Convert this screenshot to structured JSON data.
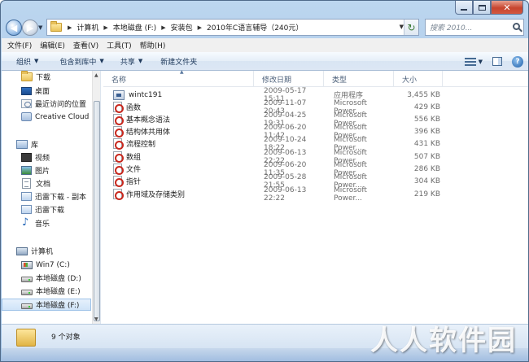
{
  "address": {
    "crumbs": [
      "计算机",
      "本地磁盘 (F:)",
      "安装包",
      "2010年C语言辅导（240元）"
    ],
    "search_placeholder": "搜索 2010..."
  },
  "menu": [
    "文件(F)",
    "编辑(E)",
    "查看(V)",
    "工具(T)",
    "帮助(H)"
  ],
  "toolbar": {
    "organize": "组织",
    "include_library": "包含到库中",
    "share": "共享",
    "new_folder": "新建文件夹"
  },
  "nav": {
    "favorites": [
      {
        "label": "下载",
        "icon": "download-folder-icon"
      },
      {
        "label": "桌面",
        "icon": "desktop-icon"
      },
      {
        "label": "最近访问的位置",
        "icon": "recent-places-icon"
      },
      {
        "label": "Creative Cloud F",
        "icon": "creative-cloud-icon"
      }
    ],
    "library_label": "库",
    "libraries": [
      {
        "label": "视频",
        "icon": "video-library-icon"
      },
      {
        "label": "图片",
        "icon": "picture-library-icon"
      },
      {
        "label": "文档",
        "icon": "document-library-icon"
      },
      {
        "label": "迅雷下载 - 副本",
        "icon": "thunder-download-icon"
      },
      {
        "label": "迅雷下载",
        "icon": "thunder-download-icon"
      },
      {
        "label": "音乐",
        "icon": "music-library-icon"
      }
    ],
    "computer_label": "计算机",
    "drives": [
      {
        "label": "Win7 (C:)",
        "icon": "windows-drive-icon"
      },
      {
        "label": "本地磁盘 (D:)",
        "icon": "hard-drive-icon"
      },
      {
        "label": "本地磁盘 (E:)",
        "icon": "hard-drive-icon"
      },
      {
        "label": "本地磁盘 (F:)",
        "icon": "hard-drive-icon"
      }
    ]
  },
  "columns": {
    "name": "名称",
    "date": "修改日期",
    "type": "类型",
    "size": "大小"
  },
  "files": [
    {
      "name": "wintc191",
      "date": "2009-05-17 15:11",
      "type": "应用程序",
      "size": "3,455 KB",
      "icon": "exe-icon"
    },
    {
      "name": "函数",
      "date": "2009-11-07 20:43",
      "type": "Microsoft Power...",
      "size": "429 KB",
      "icon": "pdf-icon"
    },
    {
      "name": "基本概念语法",
      "date": "2009-04-25 19:31",
      "type": "Microsoft Power...",
      "size": "556 KB",
      "icon": "pdf-icon"
    },
    {
      "name": "结构体共用体",
      "date": "2009-06-20 11:42",
      "type": "Microsoft Power...",
      "size": "396 KB",
      "icon": "pdf-icon"
    },
    {
      "name": "流程控制",
      "date": "2009-10-24 18:22",
      "type": "Microsoft Power...",
      "size": "431 KB",
      "icon": "pdf-icon"
    },
    {
      "name": "数组",
      "date": "2009-06-13 22:22",
      "type": "Microsoft Power...",
      "size": "507 KB",
      "icon": "pdf-icon"
    },
    {
      "name": "文件",
      "date": "2009-06-20 11:35",
      "type": "Microsoft Power...",
      "size": "286 KB",
      "icon": "pdf-icon"
    },
    {
      "name": "指针",
      "date": "2009-05-28 21:55",
      "type": "Microsoft Power...",
      "size": "304 KB",
      "icon": "pdf-icon"
    },
    {
      "name": "作用域及存储类别",
      "date": "2009-06-13 22:22",
      "type": "Microsoft Power...",
      "size": "219 KB",
      "icon": "pdf-icon"
    }
  ],
  "status": {
    "count": "9 个对象"
  },
  "watermark": "人人软件园"
}
